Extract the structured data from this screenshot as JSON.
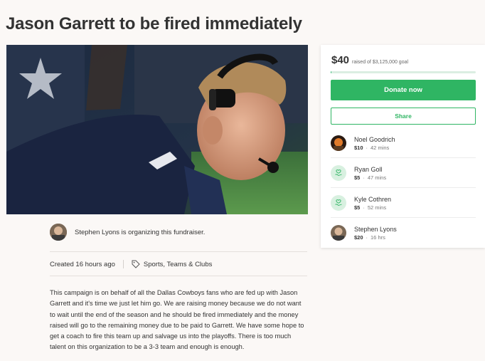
{
  "campaign": {
    "title": "Jason Garrett to be fired immediately",
    "hero_image_alt": "Coach wearing headset",
    "organizer_text": "Stephen Lyons is organizing this fundraiser.",
    "created": "Created 16 hours ago",
    "category": "Sports, Teams & Clubs",
    "description": "This campaign is on behalf of all the Dallas Cowboys fans who are fed up with Jason Garrett and it's time we just let him go. We are raising money because we do not want to wait until the end of the season  and he should be fired immediately and the money raised will go to the remaining  money due to be paid to Garrett. We have some hope to get a coach to fire this team up and salvage us into the playoffs. There is too much talent on this organization to be a 3-3 team and enough is enough."
  },
  "donation_card": {
    "amount": "$40",
    "goal_text": "raised of $3,125,000 goal",
    "progress_fraction": 1.28e-05,
    "donate_label": "Donate now",
    "share_label": "Share",
    "accent_color": "#2fb563",
    "donors": [
      {
        "name": "Noel Goodrich",
        "amount": "$10",
        "time": "42 mins",
        "avatar": "photo"
      },
      {
        "name": "Ryan Goll",
        "amount": "$5",
        "time": "47 mins",
        "avatar": "generic-hand-heart-icon"
      },
      {
        "name": "Kyle Cothren",
        "amount": "$5",
        "time": "52 mins",
        "avatar": "generic-hand-heart-icon"
      },
      {
        "name": "Stephen Lyons",
        "amount": "$20",
        "time": "16 hrs",
        "avatar": "photo"
      }
    ]
  },
  "icons": {
    "category_icon": "tag-icon"
  }
}
